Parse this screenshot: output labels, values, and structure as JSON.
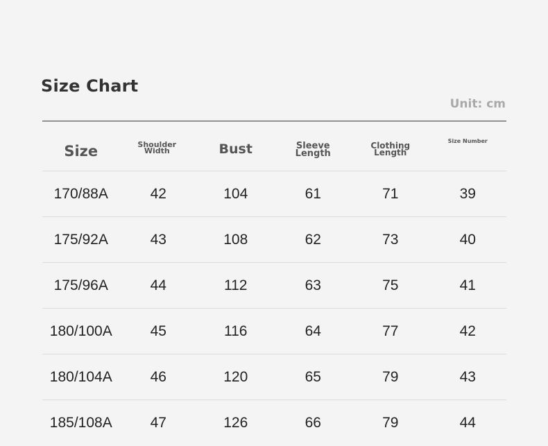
{
  "title": "Size Chart",
  "unit": "Unit: cm",
  "headers": [
    "Size",
    "Shoulder\nWidth",
    "Bust",
    "Sleeve\nLength",
    "Clothing\nLength",
    "Size Number"
  ],
  "rows": [
    [
      "170/88A",
      "42",
      "104",
      "61",
      "71",
      "39"
    ],
    [
      "175/92A",
      "43",
      "108",
      "62",
      "73",
      "40"
    ],
    [
      "175/96A",
      "44",
      "112",
      "63",
      "75",
      "41"
    ],
    [
      "180/100A",
      "45",
      "116",
      "64",
      "77",
      "42"
    ],
    [
      "180/104A",
      "46",
      "120",
      "65",
      "79",
      "43"
    ],
    [
      "185/108A",
      "47",
      "126",
      "66",
      "79",
      "44"
    ]
  ]
}
